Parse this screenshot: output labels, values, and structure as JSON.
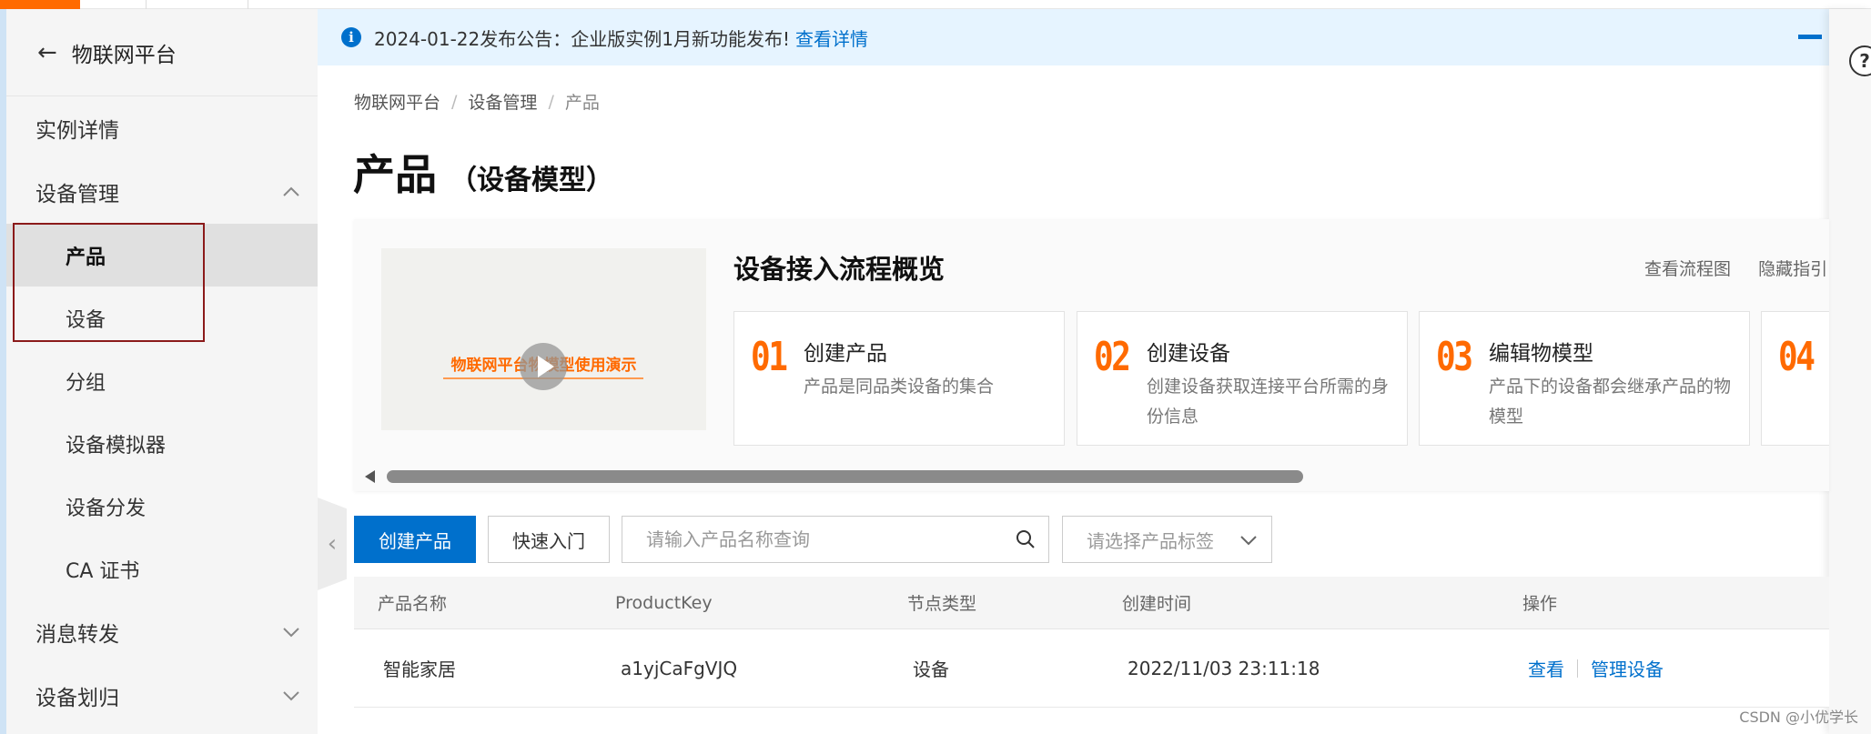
{
  "sidebar": {
    "title": "物联网平台",
    "items": [
      {
        "label": "实例详情"
      },
      {
        "label": "设备管理"
      },
      {
        "label": "产品"
      },
      {
        "label": "设备"
      },
      {
        "label": "分组"
      },
      {
        "label": "设备模拟器"
      },
      {
        "label": "设备分发"
      },
      {
        "label": "CA 证书"
      },
      {
        "label": "消息转发"
      },
      {
        "label": "设备划归"
      }
    ]
  },
  "notice": {
    "text": "2024-01-22发布公告：企业版实例1月新功能发布!",
    "link": "查看详情"
  },
  "breadcrumb": [
    "物联网平台",
    "设备管理",
    "产品"
  ],
  "page": {
    "title": "产品",
    "subtitle": "（设备模型）"
  },
  "guide": {
    "video_title": "物联网平台物模型使用演示",
    "title": "设备接入流程概览",
    "links": [
      "查看流程图",
      "隐藏指引"
    ],
    "steps": [
      {
        "num": "01",
        "title": "创建产品",
        "desc": "产品是同品类设备的集合"
      },
      {
        "num": "02",
        "title": "创建设备",
        "desc": "创建设备获取连接平台所需的身份信息"
      },
      {
        "num": "03",
        "title": "编辑物模型",
        "desc": "产品下的设备都会继承产品的物模型"
      },
      {
        "num": "04"
      }
    ]
  },
  "toolbar": {
    "create_label": "创建产品",
    "quickstart_label": "快速入门",
    "search_placeholder": "请输入产品名称查询",
    "tag_placeholder": "请选择产品标签"
  },
  "table": {
    "columns": [
      "产品名称",
      "ProductKey",
      "节点类型",
      "创建时间",
      "操作"
    ],
    "rows": [
      {
        "name": "智能家居",
        "key": "a1yjCaFgVJQ",
        "node": "设备",
        "created": "2022/11/03 23:11:18",
        "actions": [
          "查看",
          "管理设备"
        ]
      }
    ]
  },
  "watermark": "CSDN @小优学长",
  "colors": {
    "primary": "#0070cc",
    "accent": "#ff6a00",
    "highlight_box": "#8b1a1a"
  }
}
